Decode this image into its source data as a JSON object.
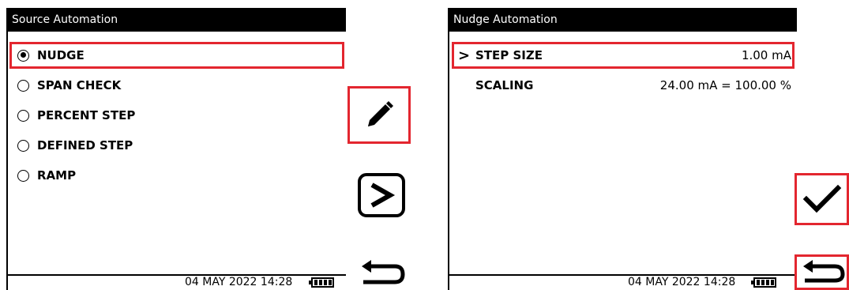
{
  "left_screen": {
    "title": "Source Automation",
    "options": [
      {
        "label": "NUDGE",
        "selected": true
      },
      {
        "label": "SPAN CHECK",
        "selected": false
      },
      {
        "label": "PERCENT STEP",
        "selected": false
      },
      {
        "label": "DEFINED STEP",
        "selected": false
      },
      {
        "label": "RAMP",
        "selected": false
      }
    ],
    "status": {
      "datetime": "04 MAY 2022 14:28"
    }
  },
  "right_screen": {
    "title": "Nudge Automation",
    "rows": [
      {
        "chevron": ">",
        "label": "STEP SIZE",
        "value": "1.00 mA"
      },
      {
        "chevron": "",
        "label": "SCALING",
        "value": "24.00 mA = 100.00 %"
      }
    ],
    "status": {
      "datetime": "04 MAY 2022 14:28"
    }
  },
  "softkeys": {
    "edit": "pencil-icon",
    "next": "chevron-right-icon",
    "back": "return-arrow-icon",
    "confirm": "checkmark-icon"
  },
  "colors": {
    "highlight": "#e3262f",
    "titlebar": "#000000"
  }
}
